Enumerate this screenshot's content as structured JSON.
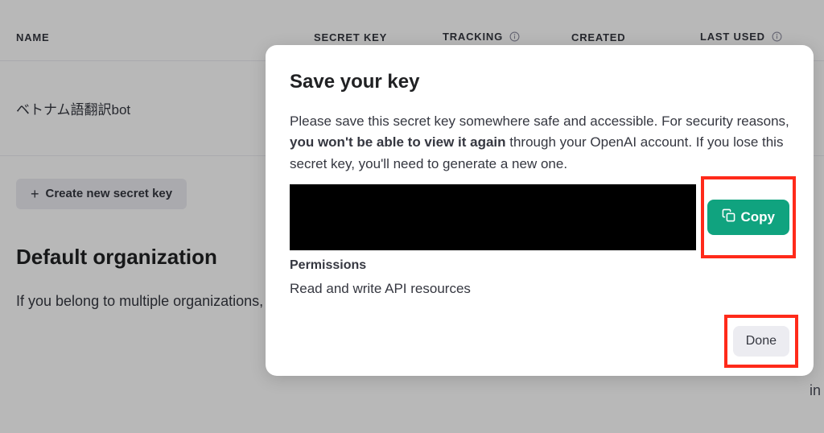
{
  "table": {
    "headers": {
      "name": "NAME",
      "secret": "SECRET KEY",
      "tracking": "TRACKING",
      "created": "CREATED",
      "lastused": "LAST USED"
    },
    "row_name": "ベトナム語翻訳bot"
  },
  "create_button": "Create new secret key",
  "org": {
    "heading": "Default organization",
    "text": "If you belong to multiple organizations, this setting controls which organization is used by default when making keys above."
  },
  "modal": {
    "title": "Save your key",
    "desc_pre": "Please save this secret key somewhere safe and accessible. For security reasons, ",
    "desc_bold": "you won't be able to view it again",
    "desc_post": " through your OpenAI account. If you lose this secret key, you'll need to generate a new one.",
    "copy": "Copy",
    "perm_head": "Permissions",
    "perm_text": "Read and write API resources",
    "done": "Done"
  },
  "cut_text": "in"
}
